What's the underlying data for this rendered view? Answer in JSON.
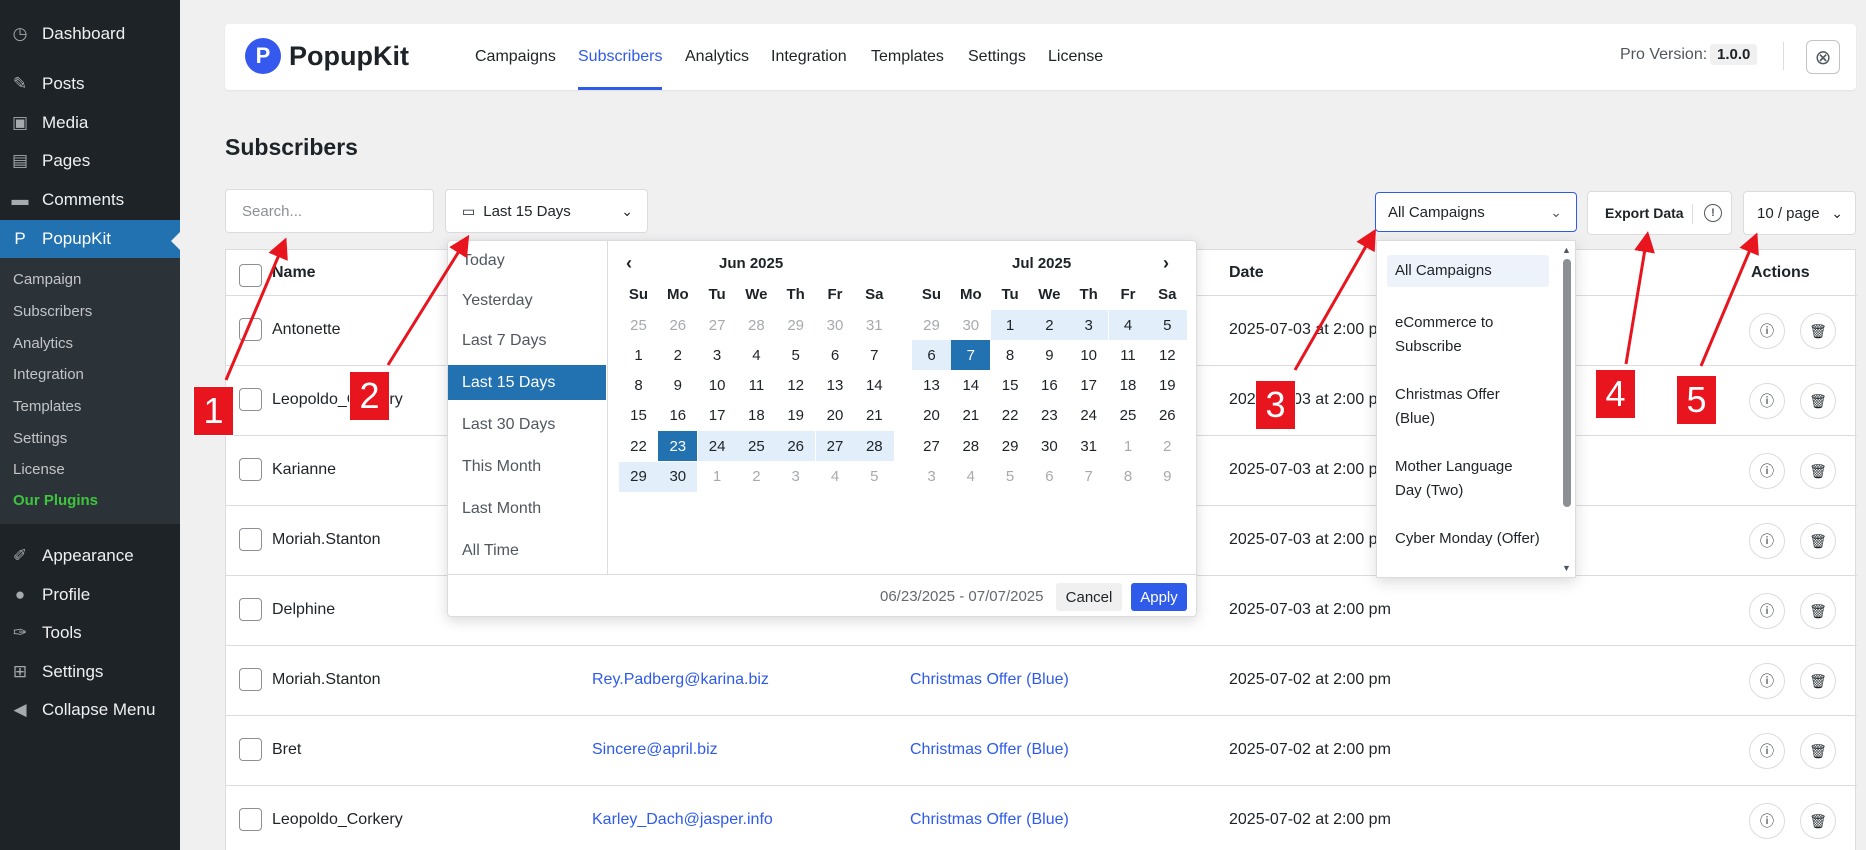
{
  "wp_menu": {
    "items": [
      {
        "icon": "dashboard-icon",
        "glyph": "◷",
        "label": "Dashboard"
      },
      {
        "icon": "pin-icon",
        "glyph": "✎",
        "label": "Posts"
      },
      {
        "icon": "media-icon",
        "glyph": "▣",
        "label": "Media"
      },
      {
        "icon": "pages-icon",
        "glyph": "▤",
        "label": "Pages"
      },
      {
        "icon": "comments-icon",
        "glyph": "▬",
        "label": "Comments"
      },
      {
        "icon": "popupkit-icon",
        "glyph": "P",
        "label": "PopupKit"
      },
      {
        "icon": "appearance-icon",
        "glyph": "✐",
        "label": "Appearance"
      },
      {
        "icon": "profile-icon",
        "glyph": "●",
        "label": "Profile"
      },
      {
        "icon": "tools-icon",
        "glyph": "✑",
        "label": "Tools"
      },
      {
        "icon": "settings-icon",
        "glyph": "⊞",
        "label": "Settings"
      },
      {
        "icon": "collapse-icon",
        "glyph": "◀",
        "label": "Collapse Menu"
      }
    ],
    "submenu": [
      "Campaign",
      "Subscribers",
      "Analytics",
      "Integration",
      "Templates",
      "Settings",
      "License",
      "Our Plugins"
    ]
  },
  "header": {
    "logo_text": "PopupKit",
    "tabs": [
      "Campaigns",
      "Subscribers",
      "Analytics",
      "Integration",
      "Templates",
      "Settings",
      "License"
    ],
    "active_tab": "Subscribers",
    "pro_label": "Pro Version:",
    "version": "1.0.0"
  },
  "page_title": "Subscribers",
  "toolbar": {
    "search_placeholder": "Search...",
    "date_range": "Last 15 Days",
    "campaign_select": "All Campaigns",
    "export_label": "Export Data",
    "per_page": "10 / page"
  },
  "table": {
    "columns": [
      "Name",
      "Date",
      "Actions"
    ],
    "rows": [
      {
        "name": "Antonette",
        "email": "",
        "campaign": "",
        "date": "2025-07-03 at 2:00 pm"
      },
      {
        "name": "Leopoldo_Corkery",
        "email": "",
        "campaign": "",
        "date": "2025-07-03 at 2:00 pm"
      },
      {
        "name": "Karianne",
        "email": "",
        "campaign": "",
        "date": "2025-07-03 at 2:00 pm"
      },
      {
        "name": "Moriah.Stanton",
        "email": "",
        "campaign": "",
        "date": "2025-07-03 at 2:00 pm"
      },
      {
        "name": "Delphine",
        "email": "",
        "campaign": "",
        "date": "2025-07-03 at 2:00 pm"
      },
      {
        "name": "Moriah.Stanton",
        "email": "Rey.Padberg@karina.biz",
        "campaign": "Christmas Offer (Blue)",
        "date": "2025-07-02 at 2:00 pm"
      },
      {
        "name": "Bret",
        "email": "Sincere@april.biz",
        "campaign": "Christmas Offer (Blue)",
        "date": "2025-07-02 at 2:00 pm"
      },
      {
        "name": "Leopoldo_Corkery",
        "email": "Karley_Dach@jasper.info",
        "campaign": "Christmas Offer (Blue)",
        "date": "2025-07-02 at 2:00 pm"
      }
    ]
  },
  "date_picker": {
    "presets": [
      "Today",
      "Yesterday",
      "Last 7 Days",
      "Last 15 Days",
      "Last 30 Days",
      "This Month",
      "Last Month",
      "All Time"
    ],
    "selected_preset": "Last 15 Days",
    "weekdays": [
      "Su",
      "Mo",
      "Tu",
      "We",
      "Th",
      "Fr",
      "Sa"
    ],
    "months": [
      {
        "title": "Jun 2025",
        "days": [
          [
            25,
            26,
            27,
            28,
            29,
            30,
            31
          ],
          [
            1,
            2,
            3,
            4,
            5,
            6,
            7
          ],
          [
            8,
            9,
            10,
            11,
            12,
            13,
            14
          ],
          [
            15,
            16,
            17,
            18,
            19,
            20,
            21
          ],
          [
            22,
            23,
            24,
            25,
            26,
            27,
            28
          ],
          [
            29,
            30,
            1,
            2,
            3,
            4,
            5
          ]
        ],
        "first_in_month": [
          false,
          true,
          true,
          true,
          true,
          false
        ],
        "range_start": 23
      },
      {
        "title": "Jul 2025",
        "days": [
          [
            29,
            30,
            1,
            2,
            3,
            4,
            5
          ],
          [
            6,
            7,
            8,
            9,
            10,
            11,
            12
          ],
          [
            13,
            14,
            15,
            16,
            17,
            18,
            19
          ],
          [
            20,
            21,
            22,
            23,
            24,
            25,
            26
          ],
          [
            27,
            28,
            29,
            30,
            31,
            1,
            2
          ],
          [
            3,
            4,
            5,
            6,
            7,
            8,
            9
          ]
        ],
        "range_end": 7
      }
    ],
    "range_text": "06/23/2025 - 07/07/2025",
    "cancel_label": "Cancel",
    "apply_label": "Apply"
  },
  "campaign_dropdown": {
    "options": [
      "All Campaigns",
      "eCommerce to Subscribe",
      "Christmas Offer (Blue)",
      "Mother Language Day (Two)",
      "Cyber Monday (Offer)"
    ],
    "selected": "All Campaigns"
  },
  "annotations": [
    "1",
    "2",
    "3",
    "4",
    "5"
  ],
  "colors": {
    "accent": "#2f5bea",
    "wp_blue": "#2271b1",
    "marker_red": "#e8141e"
  }
}
